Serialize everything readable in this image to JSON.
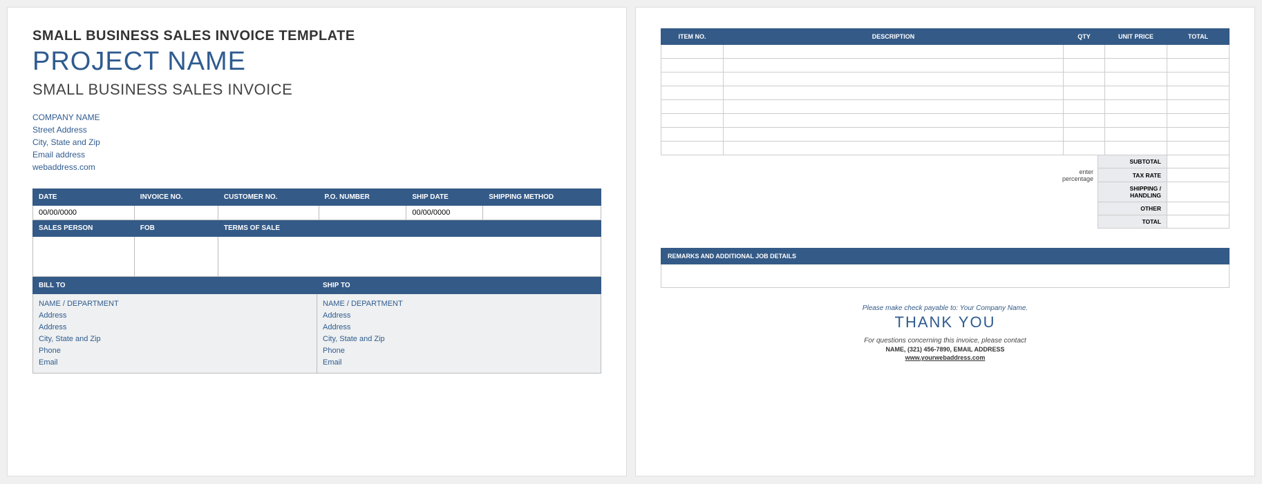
{
  "header": {
    "template_title": "SMALL BUSINESS SALES INVOICE TEMPLATE",
    "project_name": "PROJECT NAME",
    "invoice_subtitle": "SMALL BUSINESS SALES INVOICE"
  },
  "company": {
    "name": "COMPANY NAME",
    "street": "Street Address",
    "city_state_zip": "City, State and Zip",
    "email": "Email address",
    "web": "webaddress.com"
  },
  "meta": {
    "row1_headers": [
      "DATE",
      "INVOICE NO.",
      "CUSTOMER NO.",
      "P.O. NUMBER",
      "SHIP DATE",
      "SHIPPING METHOD"
    ],
    "row1_values": [
      "00/00/0000",
      "",
      "",
      "",
      "00/00/0000",
      ""
    ],
    "row2_headers": [
      "SALES PERSON",
      "FOB",
      "TERMS OF SALE"
    ],
    "row2_values": [
      "",
      "",
      ""
    ]
  },
  "bill_to_label": "BILL TO",
  "ship_to_label": "SHIP TO",
  "bill_to": {
    "name": "NAME / DEPARTMENT",
    "addr1": "Address",
    "addr2": "Address",
    "city": "City, State and Zip",
    "phone": "Phone",
    "email": "Email"
  },
  "ship_to": {
    "name": "NAME / DEPARTMENT",
    "addr1": "Address",
    "addr2": "Address",
    "city": "City, State and Zip",
    "phone": "Phone",
    "email": "Email"
  },
  "items_headers": {
    "item_no": "ITEM NO.",
    "description": "DESCRIPTION",
    "qty": "QTY",
    "unit_price": "UNIT PRICE",
    "total": "TOTAL"
  },
  "items_row_count": 8,
  "summary": {
    "subtotal_label": "SUBTOTAL",
    "tax_rate_label": "TAX RATE",
    "tax_note_line1": "enter",
    "tax_note_line2": "percentage",
    "shipping_label": "SHIPPING / HANDLING",
    "other_label": "OTHER",
    "total_label": "TOTAL"
  },
  "remarks_header": "REMARKS AND ADDITIONAL JOB DETAILS",
  "footer": {
    "payable": "Please make check payable to: Your Company Name.",
    "thankyou": "THANK YOU",
    "questions": "For questions concerning this invoice, please contact",
    "contact": "NAME, (321) 456-7890, EMAIL ADDRESS",
    "web": "www.yourwebaddress.com"
  }
}
